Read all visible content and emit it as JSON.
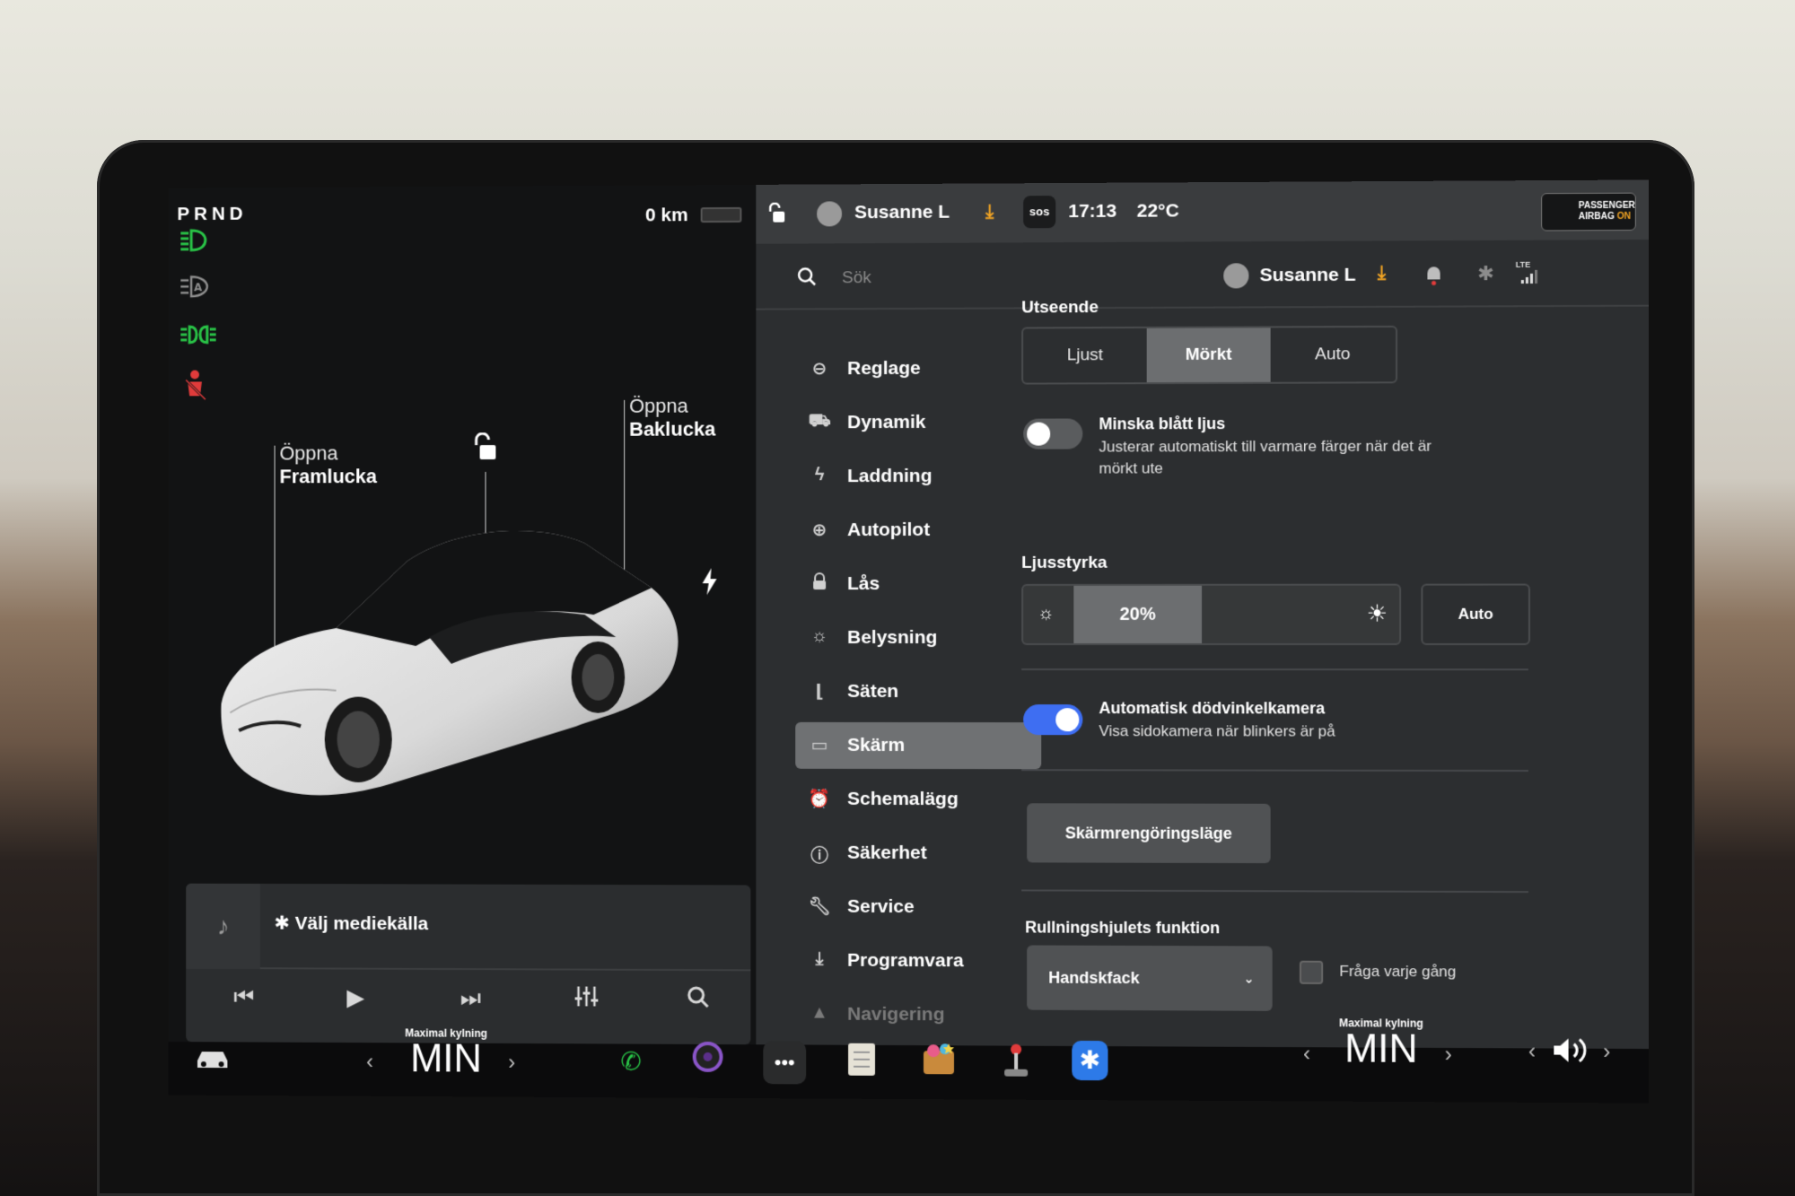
{
  "gear": {
    "label": "PRND"
  },
  "drive": {
    "odometer": "0 km"
  },
  "telltales": [
    {
      "icon": "low-beam-icon",
      "color": "#29c447"
    },
    {
      "icon": "auto-high-beam-icon",
      "color": "#8c8c8c"
    },
    {
      "icon": "parking-lights-icon",
      "color": "#29c447"
    },
    {
      "icon": "seatbelt-warning-icon",
      "color": "#e03b3b"
    }
  ],
  "car_view": {
    "frunk_action": "Öppna",
    "frunk_label": "Framlucka",
    "trunk_action": "Öppna",
    "trunk_label": "Baklucka"
  },
  "media": {
    "source_label": "Välj mediekälla",
    "bt_glyph": "✱"
  },
  "status_bar": {
    "user": "Susanne L",
    "sos": "sos",
    "time": "17:13",
    "temperature": "22°C",
    "airbag_line1": "PASSENGER",
    "airbag_line2": "AIRBAG",
    "airbag_state": "ON",
    "accent": "#f5a623"
  },
  "header": {
    "search_placeholder": "Sök",
    "user": "Susanne L",
    "network": "LTE"
  },
  "menu": [
    {
      "label": "Reglage",
      "icon": "toggle-icon"
    },
    {
      "label": "Dynamik",
      "icon": "car-icon"
    },
    {
      "label": "Laddning",
      "icon": "bolt-icon"
    },
    {
      "label": "Autopilot",
      "icon": "steering-wheel-icon"
    },
    {
      "label": "Lås",
      "icon": "lock-icon"
    },
    {
      "label": "Belysning",
      "icon": "light-icon"
    },
    {
      "label": "Säten",
      "icon": "seat-icon"
    },
    {
      "label": "Skärm",
      "icon": "display-icon",
      "active": true
    },
    {
      "label": "Schemalägg",
      "icon": "alarm-clock-icon"
    },
    {
      "label": "Säkerhet",
      "icon": "info-circle-icon"
    },
    {
      "label": "Service",
      "icon": "wrench-icon"
    },
    {
      "label": "Programvara",
      "icon": "download-icon"
    },
    {
      "label": "Navigering",
      "icon": "navigation-arrow-icon"
    }
  ],
  "display_settings": {
    "appearance": {
      "title": "Utseende",
      "options": [
        "Ljust",
        "Mörkt",
        "Auto"
      ],
      "selected": "Mörkt"
    },
    "blue_light": {
      "title": "Minska blått ljus",
      "subtitle_line1": "Justerar automatiskt till varmare färger när det är",
      "subtitle_line2": "mörkt ute",
      "enabled": false
    },
    "brightness": {
      "title": "Ljusstyrka",
      "value_label": "20%",
      "value": 20,
      "auto_label": "Auto"
    },
    "blind_spot": {
      "title": "Automatisk dödvinkelkamera",
      "subtitle": "Visa sidokamera när blinkers är på",
      "enabled": true,
      "color": "#3e6ef2"
    },
    "clean_mode_label": "Skärmrengöringsläge",
    "scroll_wheel": {
      "title": "Rullningshjulets funktion",
      "selected": "Handskfack",
      "ask_label": "Fråga varje gång"
    }
  },
  "dock": {
    "left_climate_label": "Maximal kylning",
    "left_climate_value": "MIN",
    "right_climate_label": "Maximal kylning",
    "right_climate_value": "MIN",
    "apps": [
      "phone-icon",
      "camera-icon",
      "more-icon",
      "notes-icon",
      "toybox-icon",
      "joystick-icon",
      "bluetooth-icon"
    ]
  }
}
